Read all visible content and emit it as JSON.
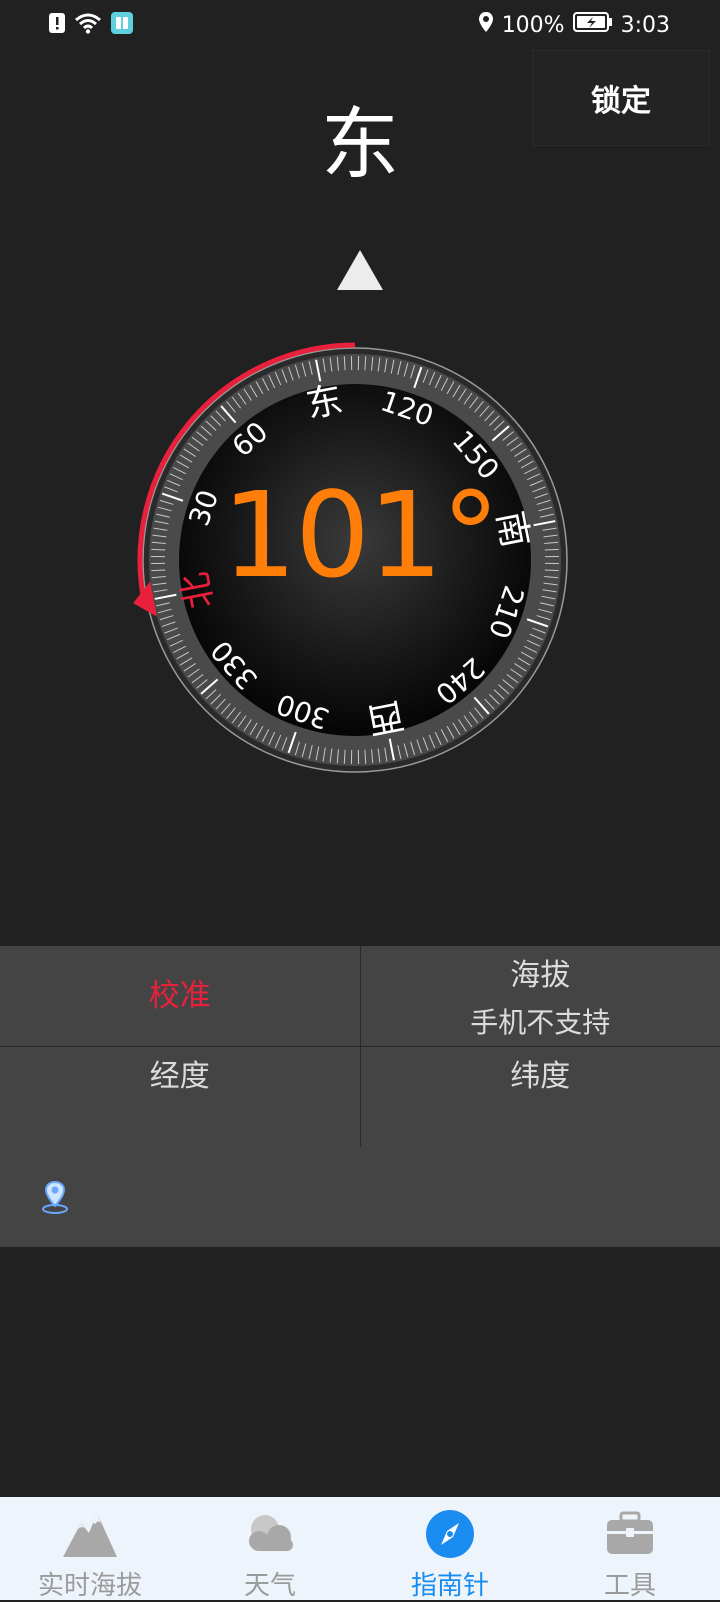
{
  "status_bar": {
    "battery": "100%",
    "time": "3:03",
    "icons": [
      "alert-icon",
      "wifi-icon",
      "app-notification-icon",
      "location-icon",
      "battery-charging-icon"
    ]
  },
  "header": {
    "lock_label": "锁定",
    "direction": "东"
  },
  "compass": {
    "heading_degrees": 101,
    "heading_text": "101°",
    "dial_labels": [
      "北",
      "30",
      "60",
      "东",
      "120",
      "150",
      "南",
      "210",
      "240",
      "西",
      "300",
      "330"
    ],
    "accent_color": "#e8203c",
    "readout_color": "#ff7e0a"
  },
  "info": {
    "calibrate_label": "校准",
    "altitude_label": "海拔",
    "altitude_value": "手机不支持",
    "longitude_label": "经度",
    "longitude_value": "",
    "latitude_label": "纬度",
    "latitude_value": "",
    "location_text": ""
  },
  "nav": {
    "items": [
      {
        "label": "实时海拔",
        "icon": "mountain-icon",
        "active": false
      },
      {
        "label": "天气",
        "icon": "cloud-icon",
        "active": false
      },
      {
        "label": "指南针",
        "icon": "compass-icon",
        "active": true
      },
      {
        "label": "工具",
        "icon": "toolbox-icon",
        "active": false
      }
    ],
    "active_color": "#1a8cf0",
    "inactive_color": "#9b9b9b"
  }
}
